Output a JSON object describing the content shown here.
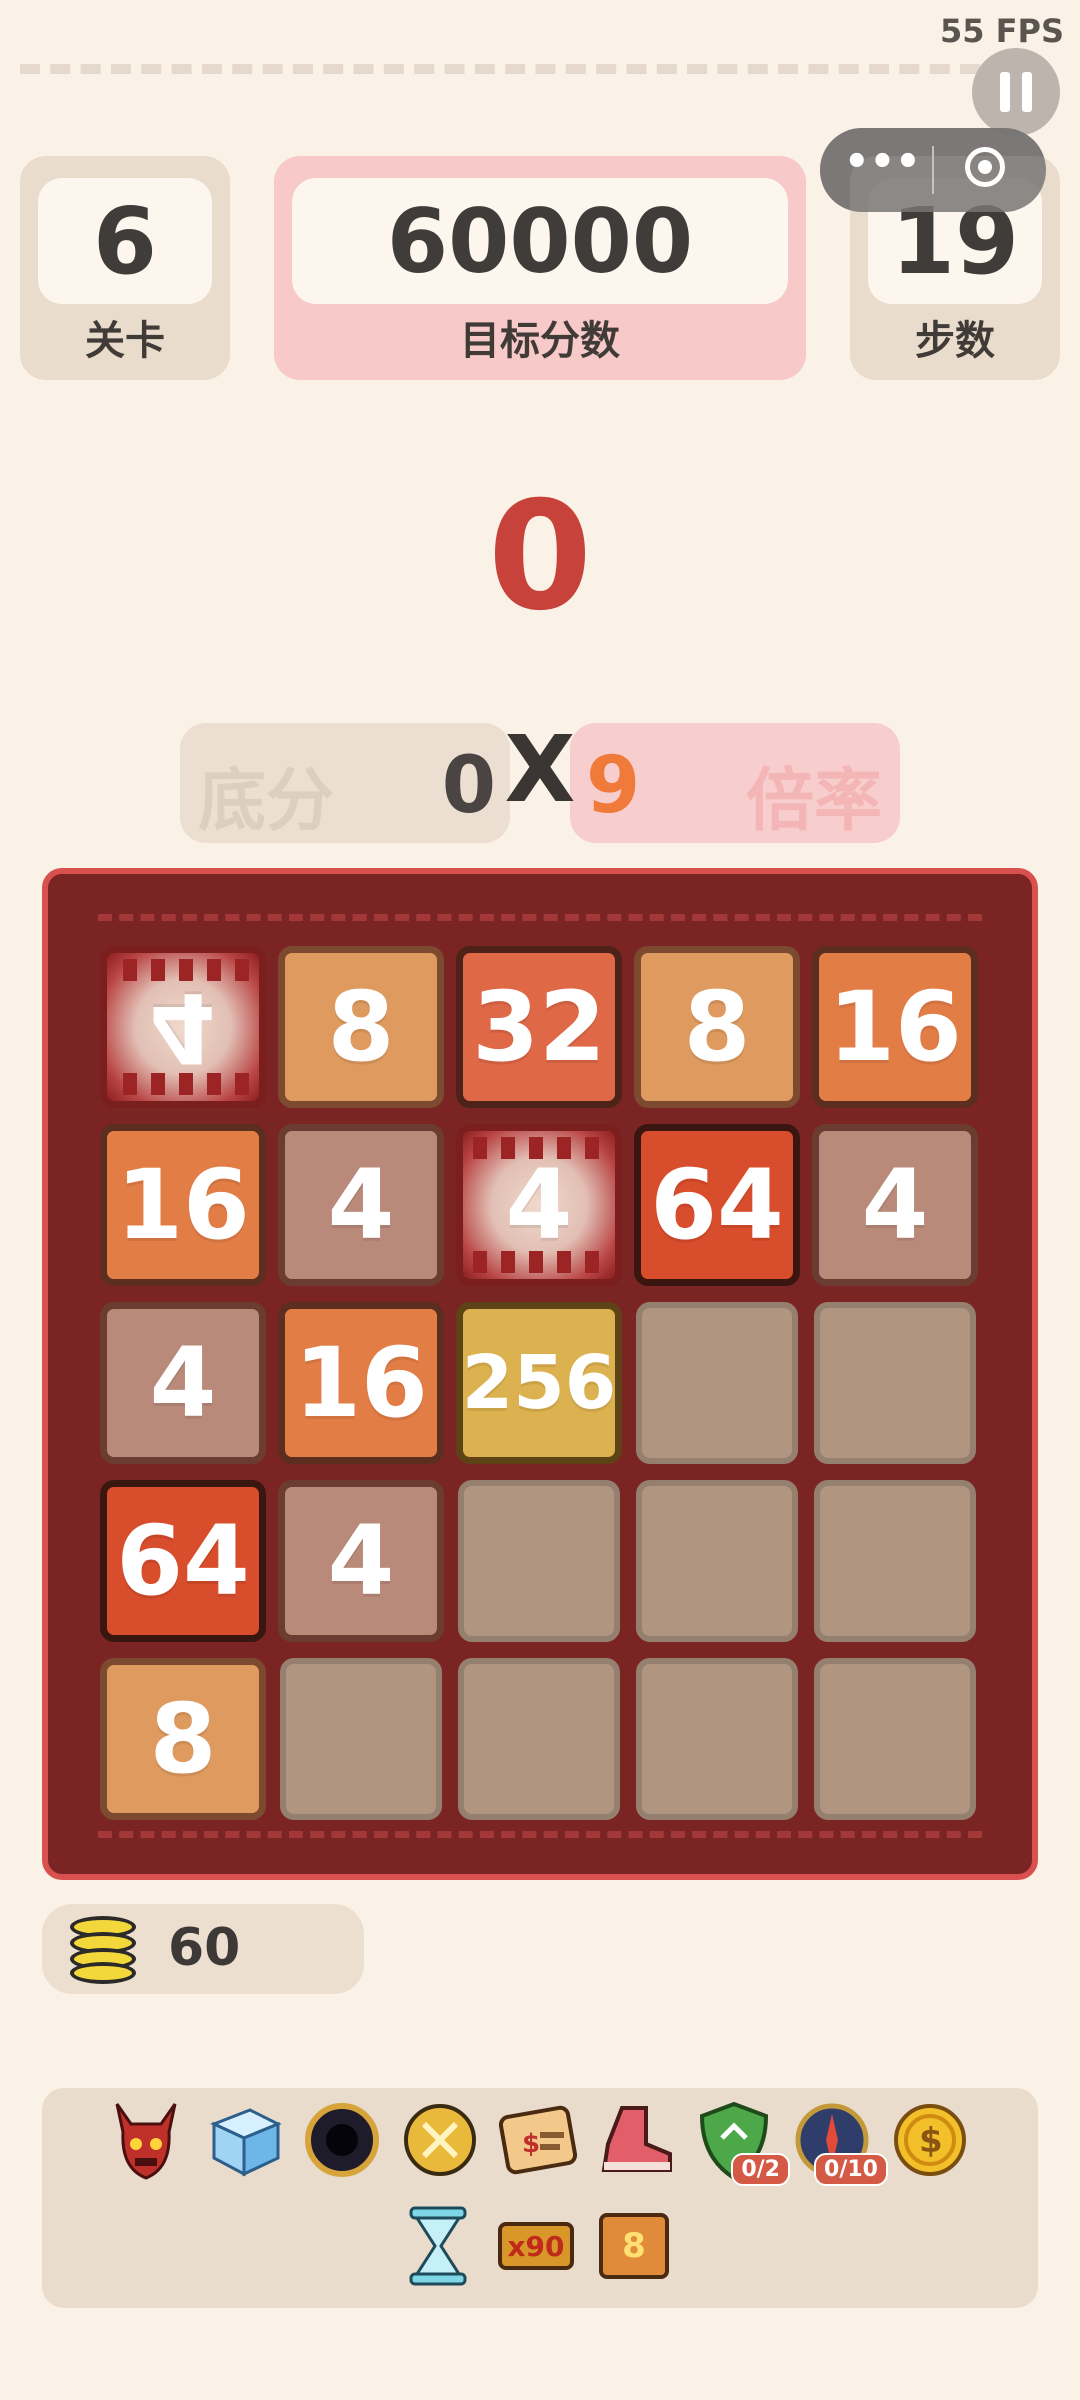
{
  "fps": "55 FPS",
  "header": {
    "level": {
      "value": "6",
      "label": "关卡"
    },
    "target": {
      "value": "60000",
      "label": "目标分数"
    },
    "steps": {
      "value": "19",
      "label": "步数"
    }
  },
  "score": "0",
  "formula": {
    "base_label": "底分",
    "base_value": "0",
    "times": "X",
    "multiplier_value": "9",
    "multiplier_label": "倍率"
  },
  "board": {
    "rows": [
      [
        {
          "v": "4",
          "kind": "monster",
          "flipped": true
        },
        {
          "v": "8"
        },
        {
          "v": "32"
        },
        {
          "v": "8"
        },
        {
          "v": "16"
        }
      ],
      [
        {
          "v": "16"
        },
        {
          "v": "4"
        },
        {
          "v": "4",
          "kind": "monster"
        },
        {
          "v": "64"
        },
        {
          "v": "4"
        }
      ],
      [
        {
          "v": "4"
        },
        {
          "v": "16"
        },
        {
          "v": "256"
        },
        null,
        null
      ],
      [
        {
          "v": "64"
        },
        {
          "v": "4"
        },
        null,
        null,
        null
      ],
      [
        {
          "v": "8"
        },
        null,
        null,
        null,
        null
      ]
    ]
  },
  "coins": "60",
  "items": [
    {
      "name": "demon-mask-icon"
    },
    {
      "name": "ice-cube-icon"
    },
    {
      "name": "black-hole-icon"
    },
    {
      "name": "sword-coin-icon"
    },
    {
      "name": "price-card-icon"
    },
    {
      "name": "boot-icon"
    },
    {
      "name": "shield-icon",
      "badge": "0/2"
    },
    {
      "name": "compass-icon",
      "badge": "0/10"
    },
    {
      "name": "gold-coin-icon"
    },
    {
      "name": "hourglass-icon"
    },
    {
      "name": "multiplier-90-icon",
      "text": "x90"
    },
    {
      "name": "crate-8-icon",
      "text": "8"
    }
  ]
}
